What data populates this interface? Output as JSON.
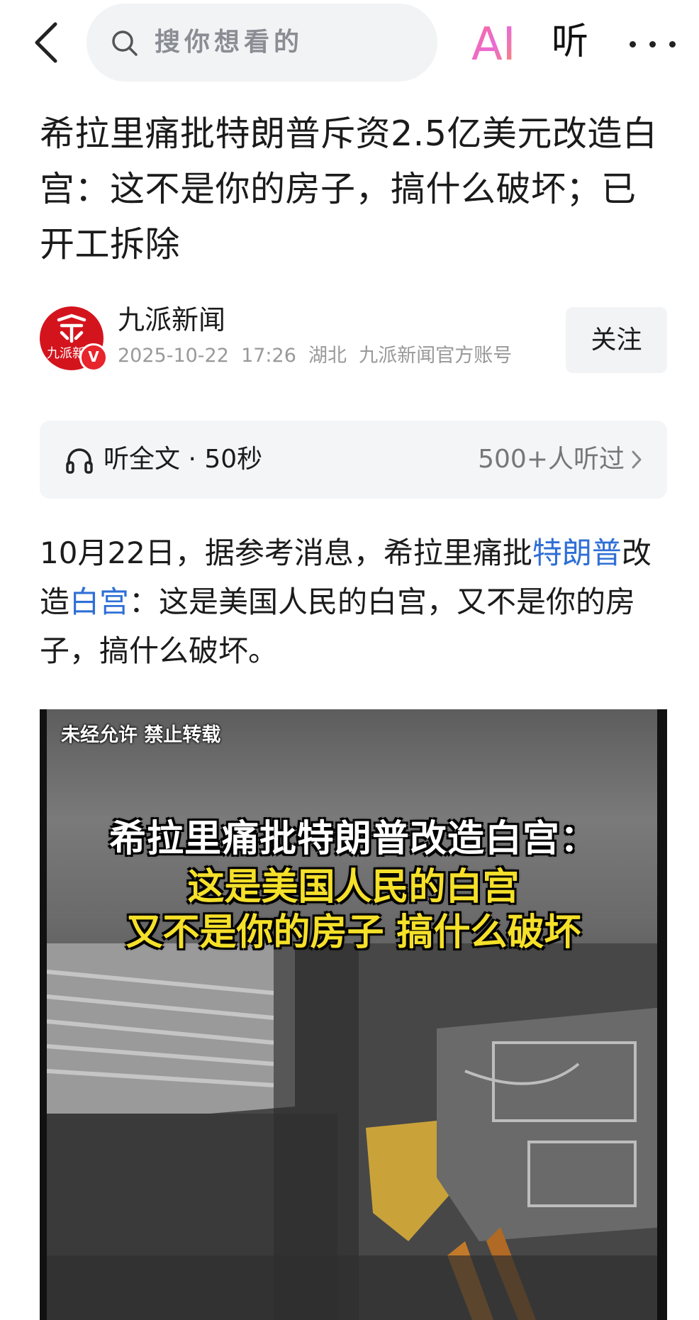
{
  "topbar": {
    "search_placeholder": "搜你想看的",
    "ai_label": "AI",
    "listen_label": "听"
  },
  "article": {
    "title": "希拉里痛批特朗普斥资2.5亿美元改造白宫：这不是你的房子，搞什么破坏；已开工拆除",
    "author": {
      "name": "九派新闻",
      "avatar_text": "九派新",
      "verified_badge": "V",
      "meta": "2025-10-22  17:26  湖北  九派新闻官方账号"
    },
    "follow_label": "关注",
    "listen": {
      "label": "听全文 · 50秒",
      "count": "500+人听过"
    },
    "paragraph": {
      "part1": "10月22日，据参考消息，希拉里痛批",
      "link1": "特朗普",
      "part2": "改造",
      "link2": "白宫",
      "part3": "：这是美国人民的白宫，又不是你的房子，搞什么破坏。"
    },
    "video": {
      "watermark": "未经允许 禁止转载",
      "caption_line1": "希拉里痛批特朗普改造白宫：",
      "caption_line2": "这是美国人民的白宫",
      "caption_line3": "又不是你的房子 搞什么破坏"
    }
  },
  "colors": {
    "link": "#2f6fd6",
    "brand_red": "#d4141d",
    "caption_yellow": "#f5e02a"
  }
}
